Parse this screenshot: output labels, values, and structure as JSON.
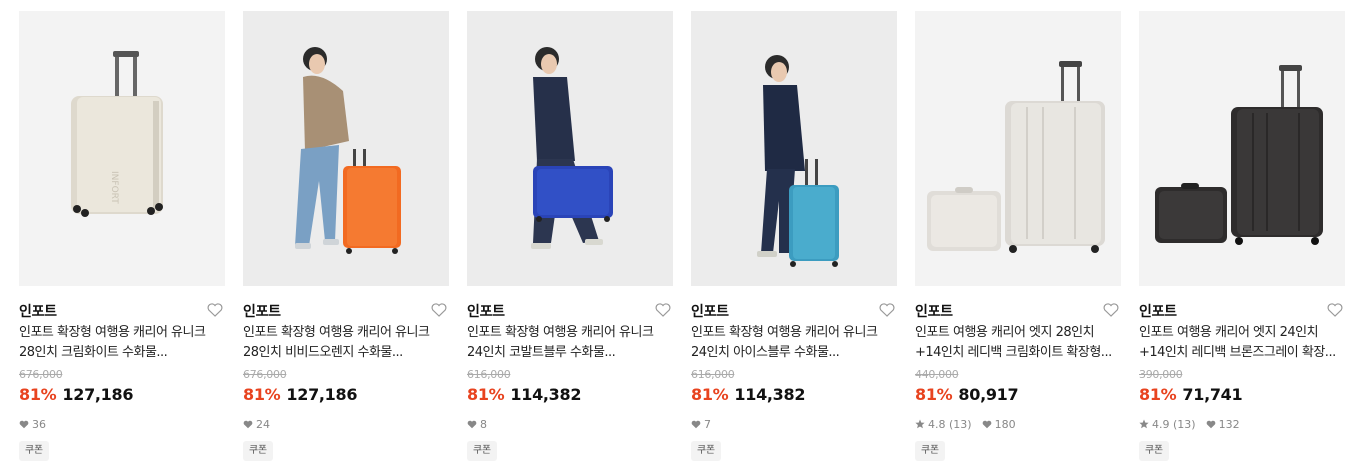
{
  "colors": {
    "discount": "#e8431f",
    "background": "#ffffff",
    "coupon_bg": "#f3f3f3"
  },
  "products": [
    {
      "brand": "인포트",
      "title_line1": "인포트 확장형 여행용 캐리어 유니크",
      "title_line2": "28인치 크림화이트 수화물...",
      "original_price": "676,000",
      "discount": "81%",
      "price": "127,186",
      "rating": "",
      "reviews": "",
      "likes": "36",
      "coupon": "쿠폰",
      "image_subject": "cream-white suitcase",
      "suitcase_color": "#e8e6dc"
    },
    {
      "brand": "인포트",
      "title_line1": "인포트 확장형 여행용 캐리어 유니크",
      "title_line2": "28인치 비비드오렌지 수화물...",
      "original_price": "676,000",
      "discount": "81%",
      "price": "127,186",
      "rating": "",
      "reviews": "",
      "likes": "24",
      "coupon": "쿠폰",
      "image_subject": "model with orange suitcase",
      "suitcase_color": "#f26a21"
    },
    {
      "brand": "인포트",
      "title_line1": "인포트 확장형 여행용 캐리어 유니크",
      "title_line2": "24인치 코발트블루 수화물...",
      "original_price": "616,000",
      "discount": "81%",
      "price": "114,382",
      "rating": "",
      "reviews": "",
      "likes": "8",
      "coupon": "쿠폰",
      "image_subject": "model with cobalt blue suitcase",
      "suitcase_color": "#2a44b8"
    },
    {
      "brand": "인포트",
      "title_line1": "인포트 확장형 여행용 캐리어 유니크",
      "title_line2": "24인치 아이스블루 수화물...",
      "original_price": "616,000",
      "discount": "81%",
      "price": "114,382",
      "rating": "",
      "reviews": "",
      "likes": "7",
      "coupon": "쿠폰",
      "image_subject": "model with ice blue suitcase",
      "suitcase_color": "#3c9cc0"
    },
    {
      "brand": "인포트",
      "title_line1": "인포트 여행용 캐리어 엣지 28인치",
      "title_line2": "+14인치 레디백 크림화이트 확장형...",
      "original_price": "440,000",
      "discount": "81%",
      "price": "80,917",
      "rating": "4.8",
      "reviews": "(13)",
      "likes": "180",
      "coupon": "쿠폰",
      "image_subject": "cream-white suitcase set",
      "suitcase_color": "#e4e2de"
    },
    {
      "brand": "인포트",
      "title_line1": "인포트 여행용 캐리어 엣지 24인치",
      "title_line2": "+14인치 레디백 브론즈그레이 확장...",
      "original_price": "390,000",
      "discount": "81%",
      "price": "71,741",
      "rating": "4.9",
      "reviews": "(13)",
      "likes": "132",
      "coupon": "쿠폰",
      "image_subject": "bronze-grey suitcase set",
      "suitcase_color": "#3a3838"
    }
  ]
}
